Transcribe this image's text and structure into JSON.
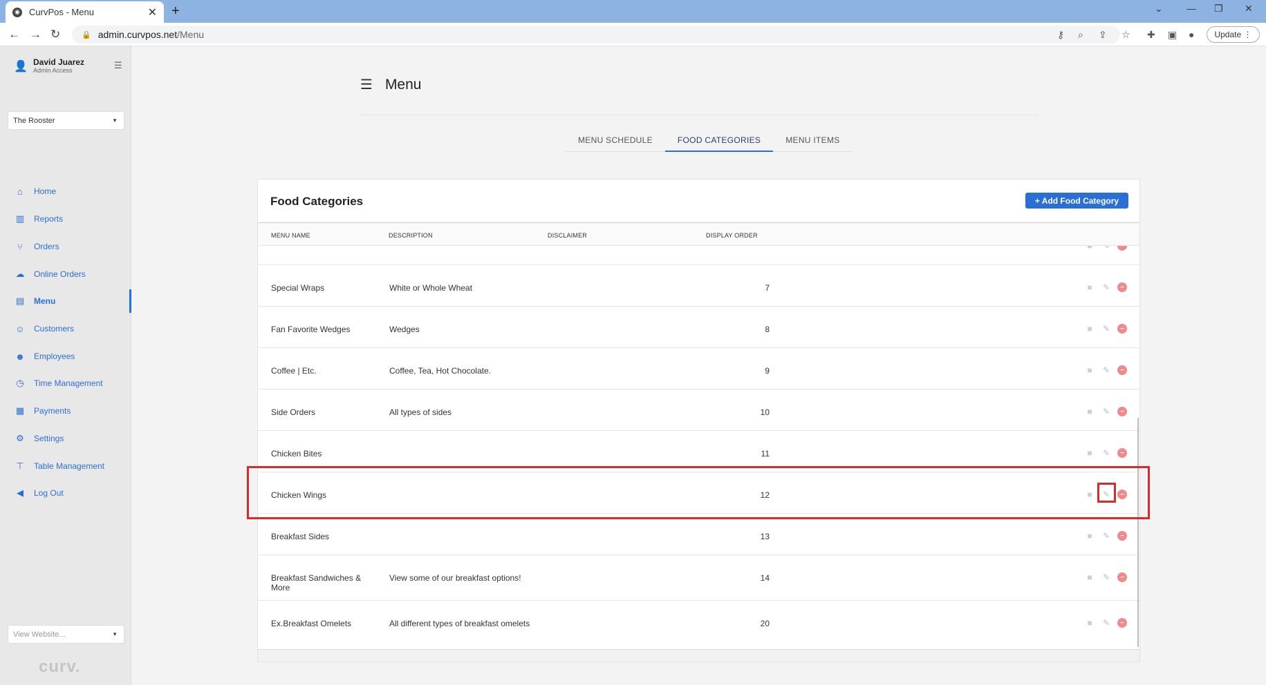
{
  "browser": {
    "tab_title": "CurvPos - Menu",
    "url_host": "admin.curvpos.net",
    "url_path": "/Menu",
    "update_label": "Update"
  },
  "sidebar": {
    "user_name": "David Juarez",
    "user_role": "Admin Access",
    "store": "The Rooster",
    "items": [
      {
        "label": "Home",
        "icon": "home-icon"
      },
      {
        "label": "Reports",
        "icon": "chart-icon"
      },
      {
        "label": "Orders",
        "icon": "utensils-icon"
      },
      {
        "label": "Online Orders",
        "icon": "cloud-icon"
      },
      {
        "label": "Menu",
        "icon": "menu-book-icon"
      },
      {
        "label": "Customers",
        "icon": "users-icon"
      },
      {
        "label": "Employees",
        "icon": "user-icon"
      },
      {
        "label": "Time Management",
        "icon": "clock-icon"
      },
      {
        "label": "Payments",
        "icon": "receipt-icon"
      },
      {
        "label": "Settings",
        "icon": "gear-icon"
      },
      {
        "label": "Table Management",
        "icon": "table-icon"
      },
      {
        "label": "Log Out",
        "icon": "arrow-left-icon"
      }
    ],
    "active_item": "Menu",
    "view_website": "View Website...",
    "brand": "curv."
  },
  "main": {
    "title": "Menu",
    "tabs": [
      {
        "label": "MENU SCHEDULE"
      },
      {
        "label": "FOOD CATEGORIES"
      },
      {
        "label": "MENU ITEMS"
      }
    ],
    "active_tab": "FOOD CATEGORIES",
    "card_title": "Food Categories",
    "add_button": "+ Add Food Category",
    "columns": [
      "MENU NAME",
      "DESCRIPTION",
      "DISCLAIMER",
      "DISPLAY ORDER"
    ],
    "rows": [
      {
        "name": "Special Wraps",
        "description": "White or Whole Wheat",
        "disclaimer": "",
        "order": "7"
      },
      {
        "name": "Fan Favorite Wedges",
        "description": "Wedges",
        "disclaimer": "",
        "order": "8"
      },
      {
        "name": "Coffee | Etc.",
        "description": "Coffee, Tea, Hot Chocolate.",
        "disclaimer": "",
        "order": "9"
      },
      {
        "name": "Side Orders",
        "description": "All types of sides",
        "disclaimer": "",
        "order": "10"
      },
      {
        "name": "Chicken Bites",
        "description": "",
        "disclaimer": "",
        "order": "11"
      },
      {
        "name": "Chicken Wings",
        "description": "",
        "disclaimer": "",
        "order": "12"
      },
      {
        "name": "Breakfast Sides",
        "description": "",
        "disclaimer": "",
        "order": "13"
      },
      {
        "name": "Breakfast Sandwiches & More",
        "description": "View some of our breakfast options!",
        "disclaimer": "",
        "order": "14"
      },
      {
        "name": "Ex.Breakfast Omelets",
        "description": "All different types of breakfast omelets",
        "disclaimer": "",
        "order": "20"
      }
    ]
  },
  "colors": {
    "accent": "#2a6fd6",
    "highlight": "#d42b2b",
    "delete": "#f08a8a"
  }
}
